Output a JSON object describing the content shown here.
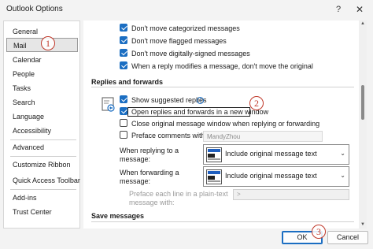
{
  "window": {
    "title": "Outlook Options",
    "help_icon": "?",
    "close_icon": "✕"
  },
  "sidebar": {
    "items": [
      {
        "label": "General"
      },
      {
        "label": "Mail"
      },
      {
        "label": "Calendar"
      },
      {
        "label": "People"
      },
      {
        "label": "Tasks"
      },
      {
        "label": "Search"
      },
      {
        "label": "Language"
      },
      {
        "label": "Accessibility"
      },
      {
        "label": "Advanced"
      },
      {
        "label": "Customize Ribbon"
      },
      {
        "label": "Quick Access Toolbar"
      },
      {
        "label": "Add-ins"
      },
      {
        "label": "Trust Center"
      }
    ],
    "selected": "Mail"
  },
  "content": {
    "top_options": [
      {
        "label": "Don't move categorized messages",
        "checked": true
      },
      {
        "label": "Don't move flagged messages",
        "checked": true
      },
      {
        "label": "Don't move digitally-signed messages",
        "checked": true
      },
      {
        "label": "When a reply modifies a message, don't move the original",
        "checked": true
      }
    ],
    "replies_section": {
      "title": "Replies and forwards",
      "show_suggested_replies": {
        "label": "Show suggested replies",
        "checked": true,
        "info_icon": "i"
      },
      "open_in_new_window": {
        "label": "Open replies and forwards in a new window",
        "checked": true
      },
      "close_original": {
        "label": "Close original message window when replying or forwarding",
        "checked": false
      },
      "preface_comments": {
        "label": "Preface comments with:",
        "checked": false,
        "value": "MandyZhou"
      },
      "when_replying": {
        "label": "When replying to a message:",
        "value": "Include original message text"
      },
      "when_forwarding": {
        "label": "When forwarding a message:",
        "value": "Include original message text"
      },
      "preface_each_line": {
        "label": "Preface each line in a plain-text message with:",
        "value": ">"
      }
    },
    "save_section": {
      "title": "Save messages"
    }
  },
  "buttons": {
    "ok": "OK",
    "cancel": "Cancel"
  },
  "annotations": {
    "marker1": "1",
    "marker2": "2",
    "marker3": "3"
  },
  "colors": {
    "accent": "#1b6ec2",
    "marker": "#c0392b"
  }
}
